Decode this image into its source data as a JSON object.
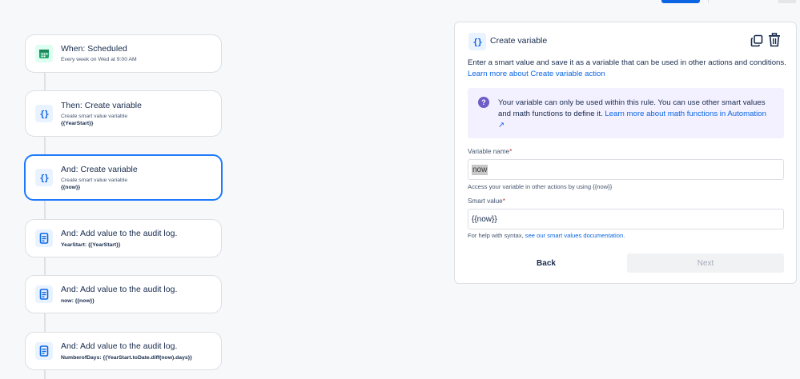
{
  "flow": {
    "trigger": {
      "title": "When: Scheduled",
      "subtitle": "Every week on Wed at 9:00 AM"
    },
    "steps": [
      {
        "title": "Then: Create variable",
        "subtitle": "Create smart value variable",
        "value": "{{YearStart}}"
      },
      {
        "title": "And: Create variable",
        "subtitle": "Create smart value variable",
        "value": "{{now}}"
      },
      {
        "title": "And: Add value to the audit log.",
        "value": "YearStart: {{YearStart}}"
      },
      {
        "title": "And: Add value to the audit log.",
        "value": "now: {{now}}"
      },
      {
        "title": "And: Add value to the audit log.",
        "value": "NumberofDays: {{YearStart.toDate.diff(now).days}}"
      }
    ]
  },
  "panel": {
    "title": "Create variable",
    "description": "Enter a smart value and save it as a variable that can be used in other actions and conditions.",
    "learn_more_link": "Learn more about Create variable action",
    "notice_text": "Your variable can only be used within this rule. You can use other smart values and math functions to define it.",
    "notice_link": "Learn more about math functions in Automation",
    "notice_link_arrow": "↗",
    "variable_name_label": "Variable name",
    "variable_name_value": "now",
    "variable_name_help": "Access your variable in other actions by using {{now}}",
    "smart_value_label": "Smart value",
    "smart_value_value": "{{now}}",
    "smart_value_help_prefix": "For help with syntax,",
    "smart_value_help_link": "see our smart values documentation",
    "smart_value_help_suffix": ".",
    "required_mark": "*",
    "back_label": "Back",
    "next_label": "Next"
  },
  "icons": {
    "trigger": "calendar-icon",
    "variable": "braces-icon",
    "audit": "document-icon",
    "copy": "copy-icon",
    "delete": "trash-icon",
    "help": "question-icon"
  },
  "colors": {
    "accent": "#0c66e4",
    "selected_border": "#1d7afc",
    "notice_bg": "#f3f0ff",
    "help_icon": "#6e5dc6"
  }
}
